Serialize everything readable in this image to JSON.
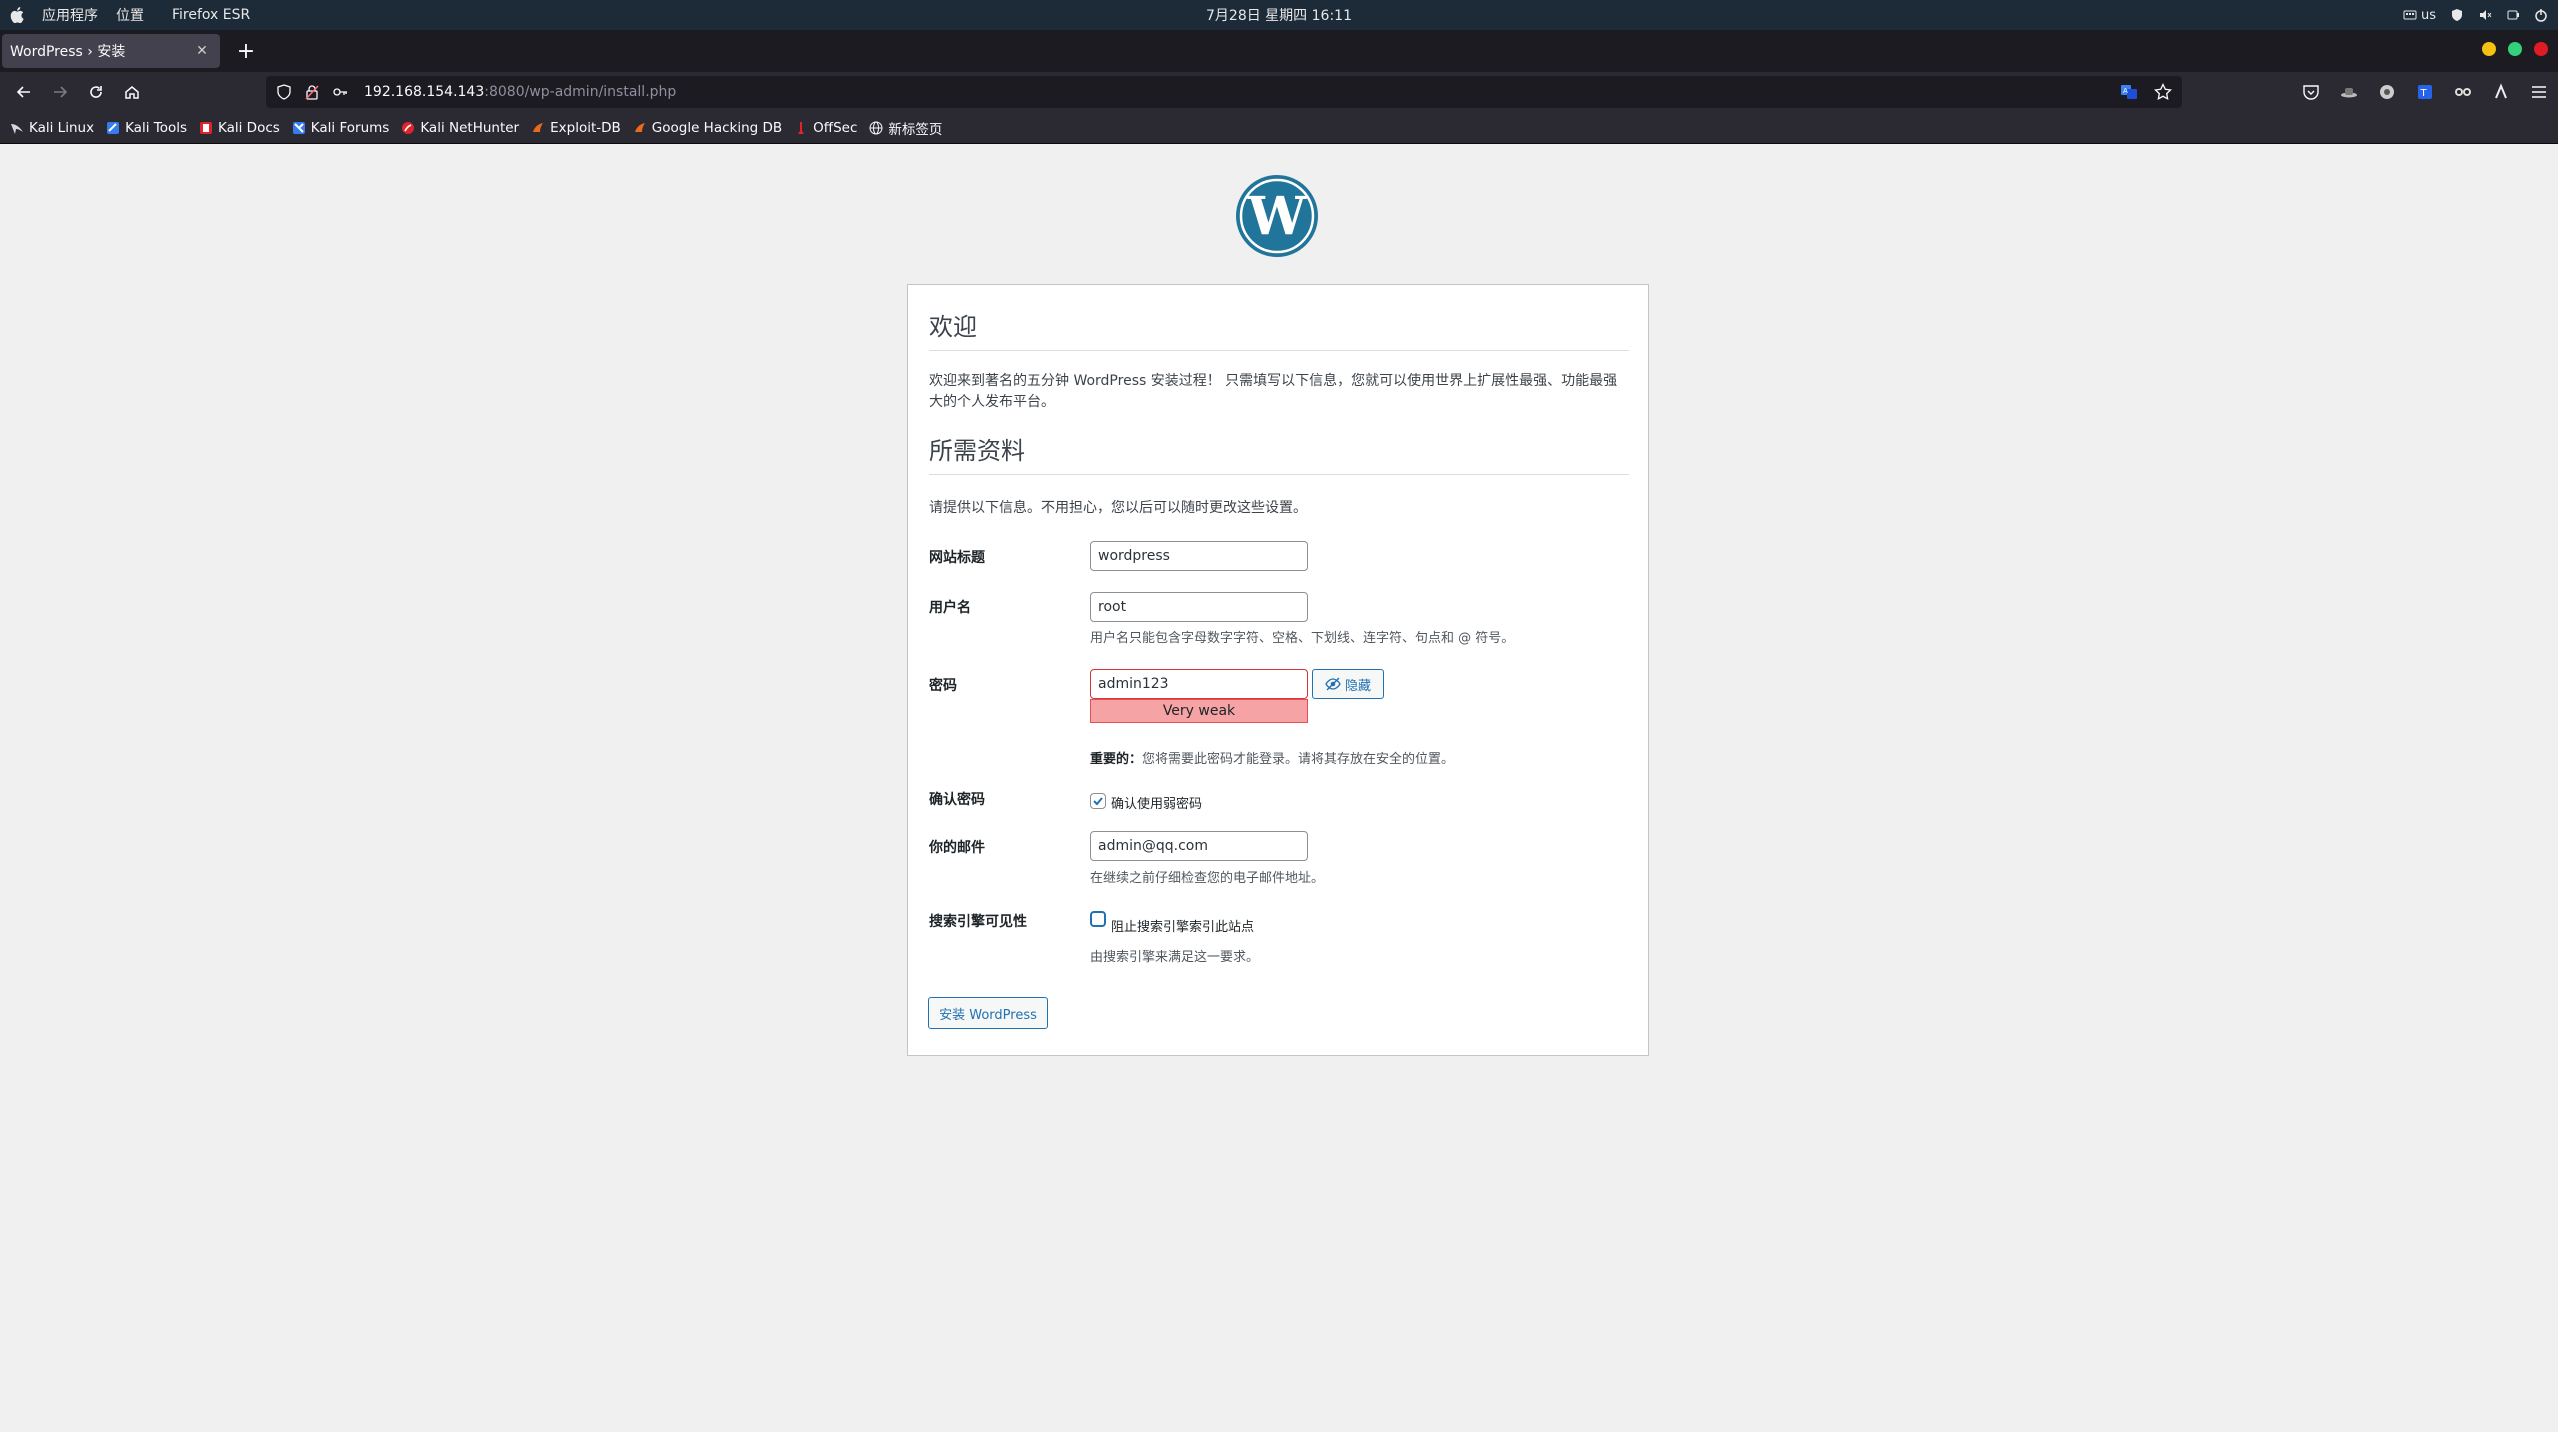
{
  "os": {
    "apps_menu": "应用程序",
    "places_menu": "位置",
    "active_app": "Firefox ESR",
    "clock": "7月28日 星期四 16:11",
    "keyboard_layout": "us"
  },
  "browser": {
    "tab_title": "WordPress › 安装",
    "url_main": "192.168.154.143",
    "url_tail": ":8080/wp-admin/install.php",
    "bookmarks": [
      "Kali Linux",
      "Kali Tools",
      "Kali Docs",
      "Kali Forums",
      "Kali NetHunter",
      "Exploit-DB",
      "Google Hacking DB",
      "OffSec",
      "新标签页"
    ]
  },
  "page": {
    "heading_welcome": "欢迎",
    "intro": "欢迎来到著名的五分钟 WordPress 安装过程！ 只需填写以下信息，您就可以使用世界上扩展性最强、功能最强大的个人发布平台。",
    "heading_info": "所需资料",
    "prompt": "请提供以下信息。不用担心，您以后可以随时更改这些设置。",
    "site_title_label": "网站标题",
    "site_title_value": "wordpress",
    "username_label": "用户名",
    "username_value": "root",
    "username_hint": "用户名只能包含字母数字字符、空格、下划线、连字符、句点和 @ 符号。",
    "password_label": "密码",
    "password_value": "admin123",
    "hide_button": "隐藏",
    "strength": "Very weak",
    "important_prefix": "重要的：",
    "important_text": "您将需要此密码才能登录。请将其存放在安全的位置。",
    "confirm_label": "确认密码",
    "confirm_checkbox": "确认使用弱密码",
    "confirm_checked": true,
    "email_label": "你的邮件",
    "email_value": "admin@qq.com",
    "email_hint": "在继续之前仔细检查您的电子邮件地址。",
    "search_label": "搜索引擎可见性",
    "search_checkbox": "阻止搜索引擎索引此站点",
    "search_checked": false,
    "search_hint": "由搜索引擎来满足这一要求。",
    "install_button": "安装 WordPress"
  },
  "colors": {
    "wp_blue": "#2271b1",
    "logo_blue": "#21759b",
    "weak_bg": "#f5a3a5",
    "os_bar": "#1d2a37"
  }
}
